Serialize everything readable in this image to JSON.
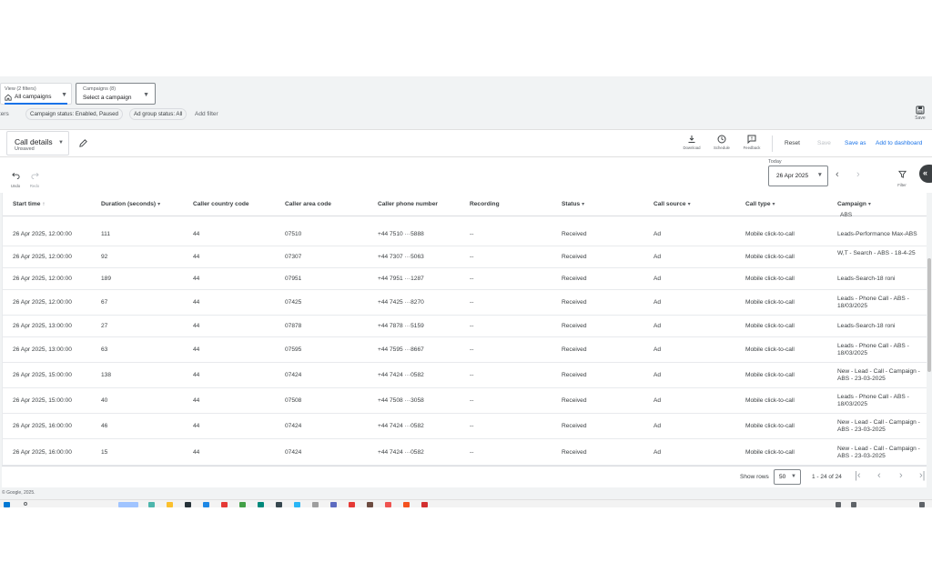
{
  "view": {
    "label": "View (2 filters)",
    "value": "All campaigns"
  },
  "campaigns": {
    "label": "Campaigns (8)",
    "value": "Select a campaign"
  },
  "filters": {
    "label": "Filters",
    "chips": [
      "Campaign status: Enabled, Paused",
      "Ad group status: All"
    ],
    "add_label": "Add filter"
  },
  "save_top_label": "Save",
  "report": {
    "title": "Call details",
    "subtitle": "Unsaved"
  },
  "toolbar": {
    "download": "Download",
    "schedule": "Schedule",
    "feedback": "Feedback",
    "reset": "Reset",
    "save": "Save",
    "save_as": "Save as",
    "add_to_dashboard": "Add to dashboard"
  },
  "history": {
    "undo": "Undo",
    "redo": "Redo"
  },
  "date": {
    "preset": "Today",
    "value": "26 Apr 2025"
  },
  "filter_tool_label": "Filter",
  "table": {
    "headers": [
      "Start time",
      "Duration (seconds)",
      "Caller country code",
      "Caller area code",
      "Caller phone number",
      "Recording",
      "Status",
      "Call source",
      "Call type",
      "Campaign"
    ],
    "partial_top": "ABS",
    "rows": [
      [
        "26 Apr 2025, 12:00:00",
        "111",
        "44",
        "07510",
        "+44 7510 ···5888",
        "--",
        "Received",
        "Ad",
        "Mobile click-to-call",
        "Leads-Performance Max-ABS"
      ],
      [
        "26 Apr 2025, 12:00:00",
        "92",
        "44",
        "07307",
        "+44 7307 ···5063",
        "--",
        "Received",
        "Ad",
        "Mobile click-to-call",
        "W,T - Search - ABS - 18-4-25"
      ],
      [
        "26 Apr 2025, 12:00:00",
        "189",
        "44",
        "07951",
        "+44 7951 ···1287",
        "--",
        "Received",
        "Ad",
        "Mobile click-to-call",
        "Leads-Search-18 roni"
      ],
      [
        "26 Apr 2025, 12:00:00",
        "67",
        "44",
        "07425",
        "+44 7425 ···8270",
        "--",
        "Received",
        "Ad",
        "Mobile click-to-call",
        "Leads - Phone Call - ABS - 18/03/2025"
      ],
      [
        "26 Apr 2025, 13:00:00",
        "27",
        "44",
        "07878",
        "+44 7878 ···5159",
        "--",
        "Received",
        "Ad",
        "Mobile click-to-call",
        "Leads-Search-18 roni"
      ],
      [
        "26 Apr 2025, 13:00:00",
        "63",
        "44",
        "07595",
        "+44 7595 ···8667",
        "--",
        "Received",
        "Ad",
        "Mobile click-to-call",
        "Leads - Phone Call - ABS - 18/03/2025"
      ],
      [
        "26 Apr 2025, 15:00:00",
        "138",
        "44",
        "07424",
        "+44 7424 ···0582",
        "--",
        "Received",
        "Ad",
        "Mobile click-to-call",
        "New - Lead - Call - Campaign - ABS - 23-03-2025"
      ],
      [
        "26 Apr 2025, 15:00:00",
        "40",
        "44",
        "07508",
        "+44 7508 ···3058",
        "--",
        "Received",
        "Ad",
        "Mobile click-to-call",
        "Leads - Phone Call - ABS - 18/03/2025"
      ],
      [
        "26 Apr 2025, 16:00:00",
        "46",
        "44",
        "07424",
        "+44 7424 ···0582",
        "--",
        "Received",
        "Ad",
        "Mobile click-to-call",
        "New - Lead - Call - Campaign - ABS - 23-03-2025"
      ],
      [
        "26 Apr 2025, 16:00:00",
        "15",
        "44",
        "07424",
        "+44 7424 ···0582",
        "--",
        "Received",
        "Ad",
        "Mobile click-to-call",
        "New - Lead - Call - Campaign - ABS - 23-03-2025"
      ]
    ]
  },
  "pager": {
    "show_rows_label": "Show rows",
    "rows_value": "50",
    "range": "1 - 24 of 24"
  },
  "copyright": "© Google, 2025.",
  "colors": {
    "accent": "#1a73e8",
    "background": "#f1f3f4"
  }
}
